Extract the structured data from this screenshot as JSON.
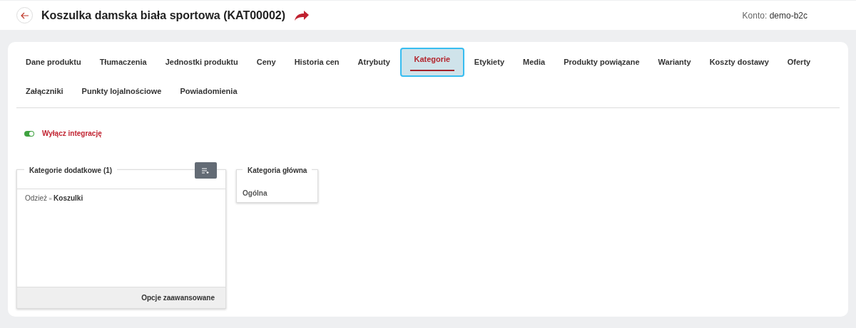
{
  "header": {
    "title": "Koszulka damska biała sportowa (KAT00002)",
    "account_label": "Konto:",
    "account": "demo-b2c"
  },
  "tabs": [
    {
      "label": "Dane produktu",
      "selected": false
    },
    {
      "label": "Tłumaczenia",
      "selected": false
    },
    {
      "label": "Jednostki produktu",
      "selected": false
    },
    {
      "label": "Ceny",
      "selected": false
    },
    {
      "label": "Historia cen",
      "selected": false
    },
    {
      "label": "Atrybuty",
      "selected": false
    },
    {
      "label": "Kategorie",
      "selected": true
    },
    {
      "label": "Etykiety",
      "selected": false
    },
    {
      "label": "Media",
      "selected": false
    },
    {
      "label": "Produkty powiązane",
      "selected": false
    },
    {
      "label": "Warianty",
      "selected": false
    },
    {
      "label": "Koszty dostawy",
      "selected": false
    },
    {
      "label": "Oferty",
      "selected": false
    },
    {
      "label": "Załączniki",
      "selected": false
    },
    {
      "label": "Punkty lojalnościowe",
      "selected": false
    },
    {
      "label": "Powiadomienia",
      "selected": false
    }
  ],
  "integration": {
    "label": "Wyłącz integrację",
    "on": true
  },
  "additional_categories": {
    "title": "Kategorie dodatkowe (1)",
    "items": [
      {
        "path": [
          "Odzież",
          "Koszulki"
        ],
        "separator": "»"
      }
    ],
    "footer": "Opcje zaawansowane"
  },
  "main_category": {
    "title": "Kategoria główna",
    "value": "Ogólna"
  }
}
